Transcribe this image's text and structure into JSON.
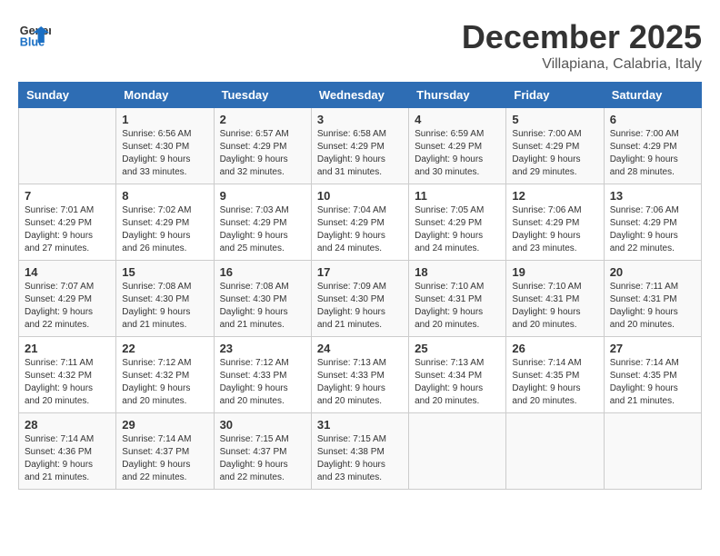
{
  "header": {
    "logo_line1": "General",
    "logo_line2": "Blue",
    "month": "December 2025",
    "location": "Villapiana, Calabria, Italy"
  },
  "days_of_week": [
    "Sunday",
    "Monday",
    "Tuesday",
    "Wednesday",
    "Thursday",
    "Friday",
    "Saturday"
  ],
  "weeks": [
    [
      {
        "day": "",
        "text": ""
      },
      {
        "day": "1",
        "text": "Sunrise: 6:56 AM\nSunset: 4:30 PM\nDaylight: 9 hours\nand 33 minutes."
      },
      {
        "day": "2",
        "text": "Sunrise: 6:57 AM\nSunset: 4:29 PM\nDaylight: 9 hours\nand 32 minutes."
      },
      {
        "day": "3",
        "text": "Sunrise: 6:58 AM\nSunset: 4:29 PM\nDaylight: 9 hours\nand 31 minutes."
      },
      {
        "day": "4",
        "text": "Sunrise: 6:59 AM\nSunset: 4:29 PM\nDaylight: 9 hours\nand 30 minutes."
      },
      {
        "day": "5",
        "text": "Sunrise: 7:00 AM\nSunset: 4:29 PM\nDaylight: 9 hours\nand 29 minutes."
      },
      {
        "day": "6",
        "text": "Sunrise: 7:00 AM\nSunset: 4:29 PM\nDaylight: 9 hours\nand 28 minutes."
      }
    ],
    [
      {
        "day": "7",
        "text": "Sunrise: 7:01 AM\nSunset: 4:29 PM\nDaylight: 9 hours\nand 27 minutes."
      },
      {
        "day": "8",
        "text": "Sunrise: 7:02 AM\nSunset: 4:29 PM\nDaylight: 9 hours\nand 26 minutes."
      },
      {
        "day": "9",
        "text": "Sunrise: 7:03 AM\nSunset: 4:29 PM\nDaylight: 9 hours\nand 25 minutes."
      },
      {
        "day": "10",
        "text": "Sunrise: 7:04 AM\nSunset: 4:29 PM\nDaylight: 9 hours\nand 24 minutes."
      },
      {
        "day": "11",
        "text": "Sunrise: 7:05 AM\nSunset: 4:29 PM\nDaylight: 9 hours\nand 24 minutes."
      },
      {
        "day": "12",
        "text": "Sunrise: 7:06 AM\nSunset: 4:29 PM\nDaylight: 9 hours\nand 23 minutes."
      },
      {
        "day": "13",
        "text": "Sunrise: 7:06 AM\nSunset: 4:29 PM\nDaylight: 9 hours\nand 22 minutes."
      }
    ],
    [
      {
        "day": "14",
        "text": "Sunrise: 7:07 AM\nSunset: 4:29 PM\nDaylight: 9 hours\nand 22 minutes."
      },
      {
        "day": "15",
        "text": "Sunrise: 7:08 AM\nSunset: 4:30 PM\nDaylight: 9 hours\nand 21 minutes."
      },
      {
        "day": "16",
        "text": "Sunrise: 7:08 AM\nSunset: 4:30 PM\nDaylight: 9 hours\nand 21 minutes."
      },
      {
        "day": "17",
        "text": "Sunrise: 7:09 AM\nSunset: 4:30 PM\nDaylight: 9 hours\nand 21 minutes."
      },
      {
        "day": "18",
        "text": "Sunrise: 7:10 AM\nSunset: 4:31 PM\nDaylight: 9 hours\nand 20 minutes."
      },
      {
        "day": "19",
        "text": "Sunrise: 7:10 AM\nSunset: 4:31 PM\nDaylight: 9 hours\nand 20 minutes."
      },
      {
        "day": "20",
        "text": "Sunrise: 7:11 AM\nSunset: 4:31 PM\nDaylight: 9 hours\nand 20 minutes."
      }
    ],
    [
      {
        "day": "21",
        "text": "Sunrise: 7:11 AM\nSunset: 4:32 PM\nDaylight: 9 hours\nand 20 minutes."
      },
      {
        "day": "22",
        "text": "Sunrise: 7:12 AM\nSunset: 4:32 PM\nDaylight: 9 hours\nand 20 minutes."
      },
      {
        "day": "23",
        "text": "Sunrise: 7:12 AM\nSunset: 4:33 PM\nDaylight: 9 hours\nand 20 minutes."
      },
      {
        "day": "24",
        "text": "Sunrise: 7:13 AM\nSunset: 4:33 PM\nDaylight: 9 hours\nand 20 minutes."
      },
      {
        "day": "25",
        "text": "Sunrise: 7:13 AM\nSunset: 4:34 PM\nDaylight: 9 hours\nand 20 minutes."
      },
      {
        "day": "26",
        "text": "Sunrise: 7:14 AM\nSunset: 4:35 PM\nDaylight: 9 hours\nand 20 minutes."
      },
      {
        "day": "27",
        "text": "Sunrise: 7:14 AM\nSunset: 4:35 PM\nDaylight: 9 hours\nand 21 minutes."
      }
    ],
    [
      {
        "day": "28",
        "text": "Sunrise: 7:14 AM\nSunset: 4:36 PM\nDaylight: 9 hours\nand 21 minutes."
      },
      {
        "day": "29",
        "text": "Sunrise: 7:14 AM\nSunset: 4:37 PM\nDaylight: 9 hours\nand 22 minutes."
      },
      {
        "day": "30",
        "text": "Sunrise: 7:15 AM\nSunset: 4:37 PM\nDaylight: 9 hours\nand 22 minutes."
      },
      {
        "day": "31",
        "text": "Sunrise: 7:15 AM\nSunset: 4:38 PM\nDaylight: 9 hours\nand 23 minutes."
      },
      {
        "day": "",
        "text": ""
      },
      {
        "day": "",
        "text": ""
      },
      {
        "day": "",
        "text": ""
      }
    ]
  ]
}
